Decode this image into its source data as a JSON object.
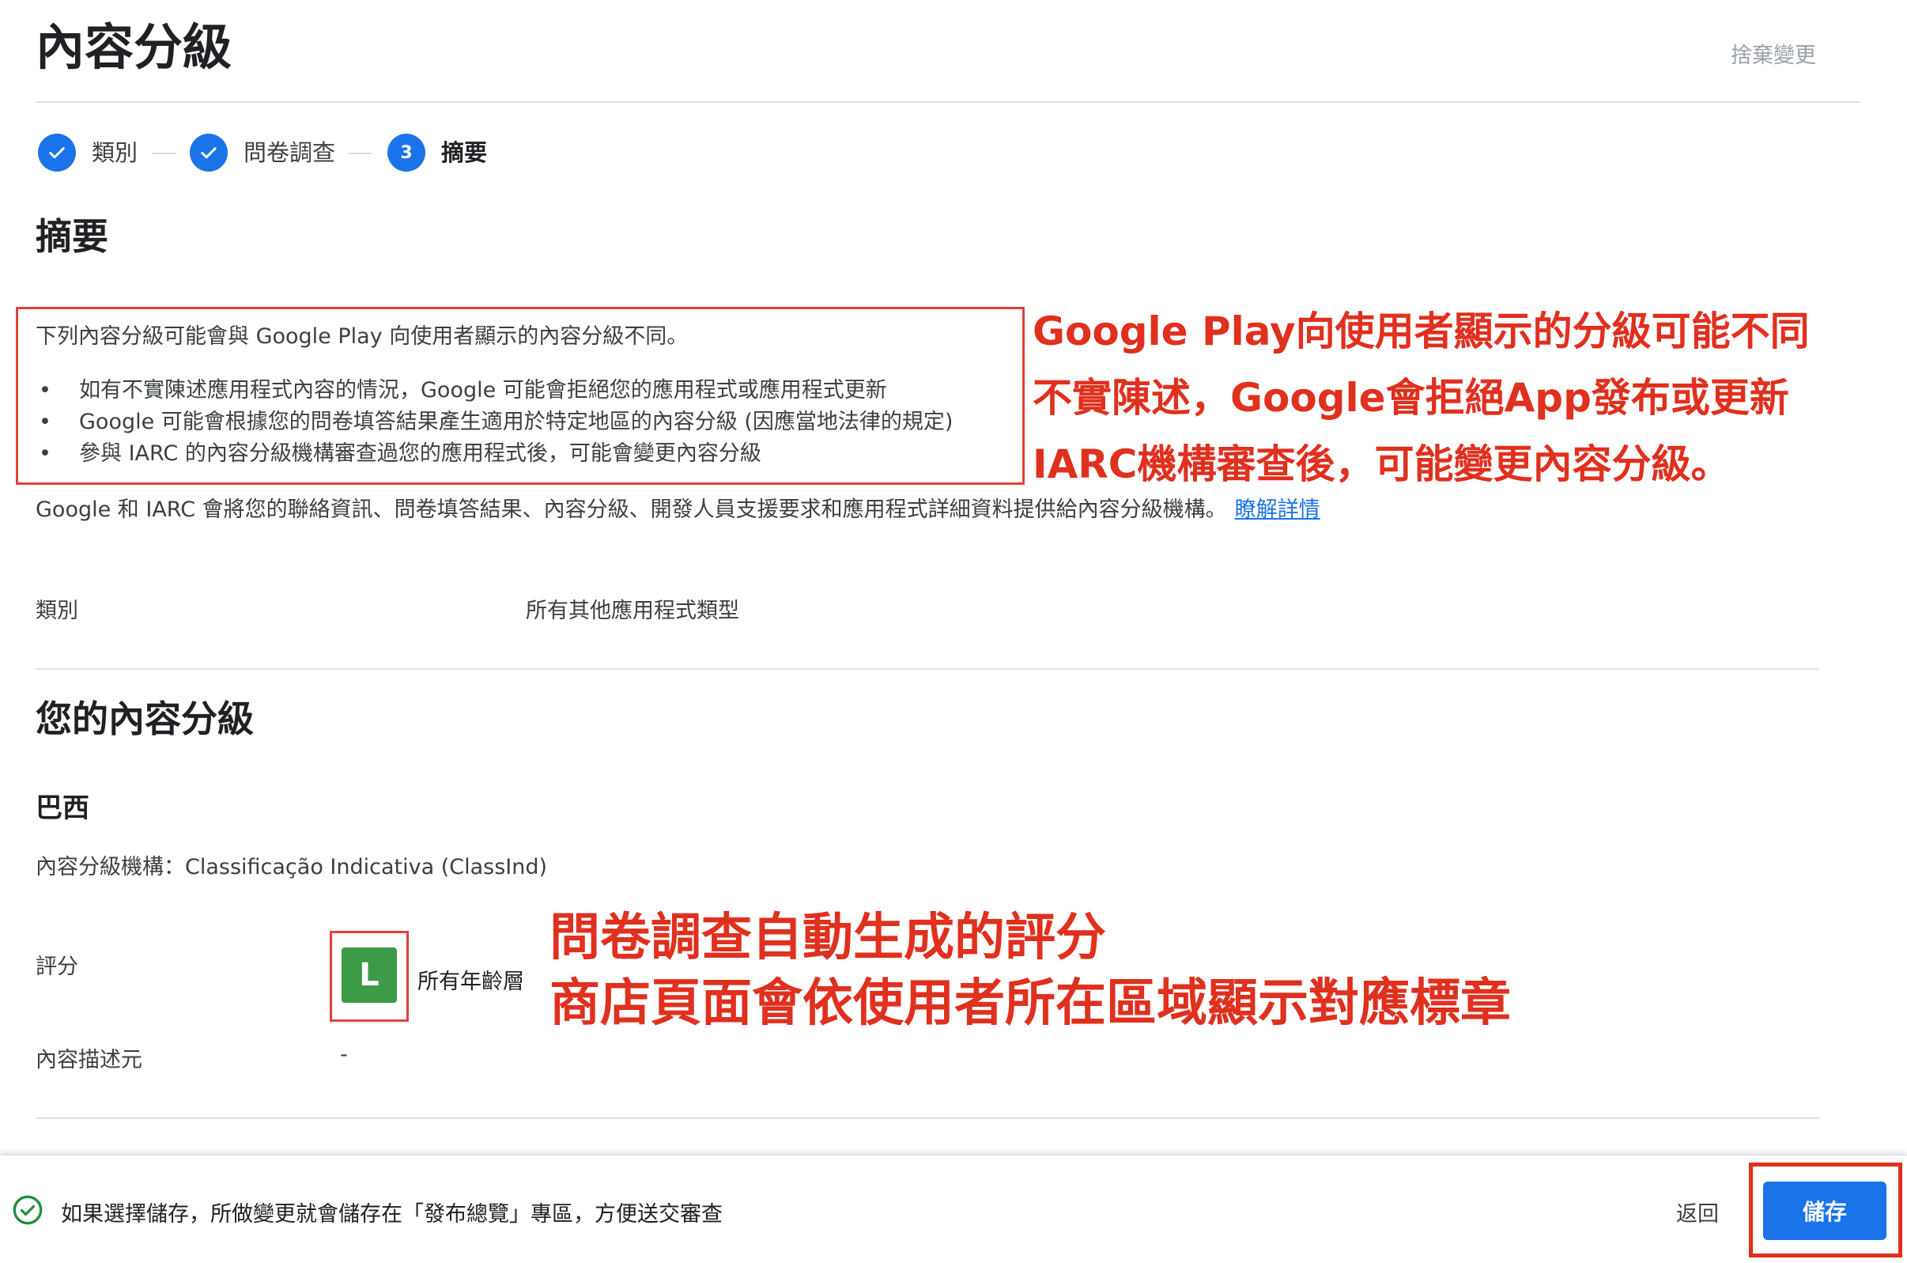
{
  "header": {
    "title": "內容分級",
    "discard_label": "捨棄變更"
  },
  "stepper": {
    "steps": [
      {
        "label": "類別",
        "state": "done"
      },
      {
        "label": "問卷調查",
        "state": "done"
      },
      {
        "label": "摘要",
        "state": "current",
        "number": "3"
      }
    ]
  },
  "summary": {
    "heading": "摘要",
    "notice_intro": "下列內容分級可能會與 Google Play 向使用者顯示的內容分級不同。",
    "notice_items": [
      "如有不實陳述應用程式內容的情況，Google 可能會拒絕您的應用程式或應用程式更新",
      "Google 可能會根據您的問卷填答結果產生適用於特定地區的內容分級 (因應當地法律的規定)",
      "參與 IARC 的內容分級機構審查過您的應用程式後，可能會變更內容分級"
    ],
    "info_text": "Google 和 IARC 會將您的聯絡資訊、問卷填答結果、內容分級、開發人員支援要求和應用程式詳細資料提供給內容分級機構。",
    "info_link": "瞭解詳情",
    "category_label": "類別",
    "category_value": "所有其他應用程式類型"
  },
  "ratings": {
    "heading": "您的內容分級",
    "country": "巴西",
    "authority": "內容分級機構：Classificação Indicativa (ClassInd)",
    "rating_label": "評分",
    "badge_letter": "L",
    "badge_color": "#3d9b48",
    "badge_text": "所有年齡層",
    "descriptors_label": "內容描述元",
    "descriptors_value": "-"
  },
  "annotations": {
    "notice_lines": [
      "Google Play向使用者顯示的分級可能不同",
      "不實陳述，Google會拒絕App發布或更新",
      "IARC機構審查後，可能變更內容分級。"
    ],
    "rating_lines": [
      "問卷調查自動生成的評分",
      "商店頁面會依使用者所在區域顯示對應標章"
    ],
    "color": "#e0301e"
  },
  "footer": {
    "message": "如果選擇儲存，所做變更就會儲存在「發布總覽」專區，方便送交審查",
    "back_label": "返回",
    "save_label": "儲存"
  },
  "colors": {
    "accent": "#1a73e8",
    "annotation": "#e0301e"
  }
}
